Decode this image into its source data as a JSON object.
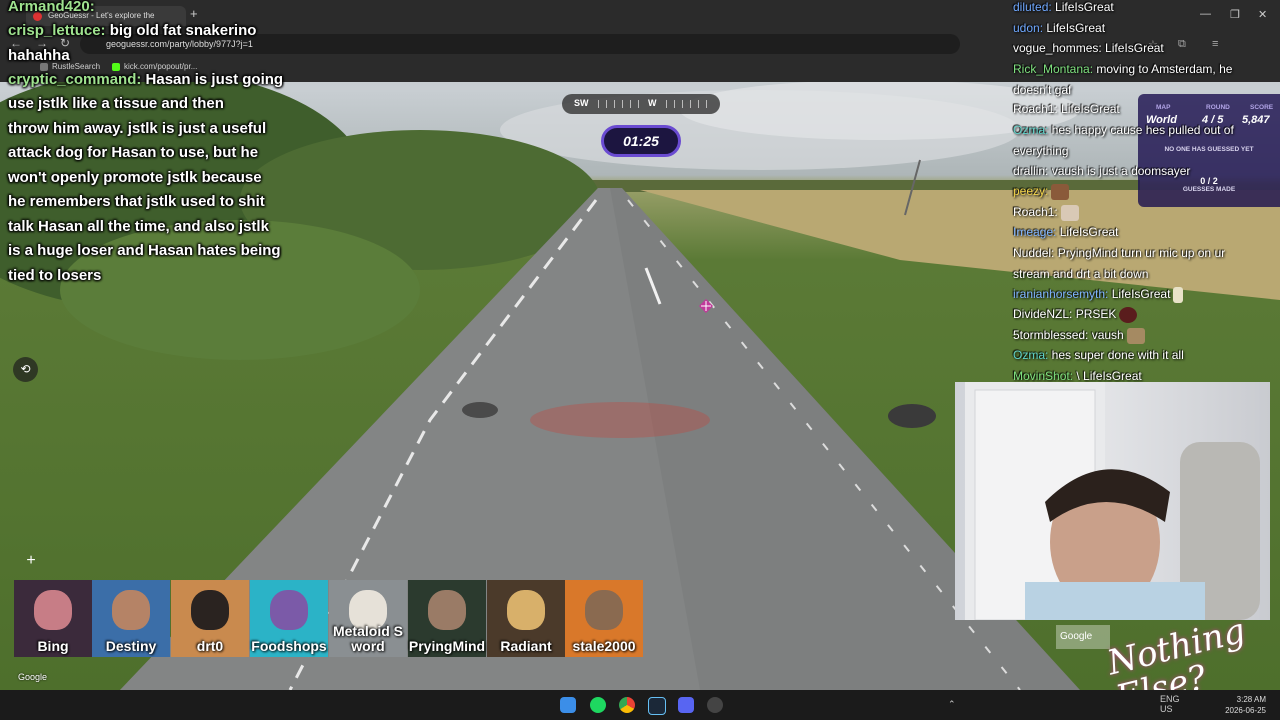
{
  "browser": {
    "tab_title": "GeoGuessr - Let's explore the",
    "new_tab": "+",
    "address": "geoguessr.com/party/lobby/977J?j=1",
    "bookmarks": [
      "RustleSearch",
      "kick.com/popout/pr..."
    ],
    "window_controls": [
      "—",
      "❐",
      "✕"
    ]
  },
  "left_chat": [
    {
      "user": "Armand420:",
      "text": ""
    },
    {
      "user": "crisp_lettuce:",
      "text": " big old fat snakerino"
    },
    {
      "user": "",
      "text": "hahahha"
    },
    {
      "user": "cryptic_command:",
      "text": " Hasan is just going"
    },
    {
      "user": "",
      "text": "use jstlk like a tissue and then"
    },
    {
      "user": "",
      "text": "throw him away. jstlk is just a useful"
    },
    {
      "user": "",
      "text": "attack dog for Hasan to use, but he"
    },
    {
      "user": "",
      "text": "won't openly promote jstlk because"
    },
    {
      "user": "",
      "text": "he remembers that jstlk used to shit"
    },
    {
      "user": "",
      "text": "talk Hasan all the time, and also jstlk"
    },
    {
      "user": "",
      "text": "is a huge loser and Hasan hates being"
    },
    {
      "user": "",
      "text": "tied to losers"
    }
  ],
  "right_chat": [
    {
      "user": "diluted:",
      "text": " LifeIsGreat",
      "color": "#6fa8ff",
      "emote": ""
    },
    {
      "user": "udon:",
      "text": " LifeIsGreat",
      "color": "#6fa8ff",
      "emote": ""
    },
    {
      "user": "vogue_hommes:",
      "text": " LifeIsGreat",
      "color": "#ffffff",
      "emote": ""
    },
    {
      "user": "Rick_Montana:",
      "text": " moving to Amsterdam, he doesn't gaf",
      "color": "#7ee07e",
      "emote": ""
    },
    {
      "user": "Roach1:",
      "text": " LifeIsGreat",
      "color": "#ffffff",
      "emote": ""
    },
    {
      "user": "Ozma:",
      "text": " hes happy cause hes pulled out of everything",
      "color": "#5fd1c8",
      "emote": ""
    },
    {
      "user": "drallin:",
      "text": " vaush is just a doomsayer",
      "color": "#ffffff",
      "emote": ""
    },
    {
      "user": "peezy:",
      "text": "",
      "color": "#f0d24a",
      "emote": "#8a5a3a"
    },
    {
      "user": "Roach1:",
      "text": "",
      "color": "#ffffff",
      "emote": "#d9c9b6"
    },
    {
      "user": "Imeage:",
      "text": " LifeIsGreat",
      "color": "#7fb4ff",
      "emote": ""
    },
    {
      "user": "Nuddel:",
      "text": " PryingMind turn ur mic up on ur stream and drt a bit down",
      "color": "#ffffff",
      "emote": ""
    },
    {
      "user": "iranianhorsemyth:",
      "text": " LifeIsGreat",
      "color": "#7fb4ff",
      "emote": "#e8e2c8"
    },
    {
      "user": "DivideNZL:",
      "text": " PRSEK",
      "color": "#ffffff",
      "emote": "#5a1d1d"
    },
    {
      "user": "5tormblessed:",
      "text": " vaush",
      "color": "#ffffff",
      "emote": "#a58a62"
    },
    {
      "user": "Ozma:",
      "text": " hes super done with it all",
      "color": "#5fd1c8",
      "emote": ""
    },
    {
      "user": "MovinShot:",
      "text": " \\ LifeIsGreat",
      "color": "#7ee07e",
      "emote": ""
    }
  ],
  "hud": {
    "compass": {
      "left": "SW",
      "center": "W"
    },
    "timer": "01:25",
    "map_label": "MAP",
    "map_value": "World",
    "round_label": "ROUND",
    "round_value": "4 / 5",
    "score_label": "SCORE",
    "score_value": "5,847",
    "guess_status": "NO ONE HAS GUESSED YET",
    "guess_count": "0 / 2",
    "guess_label": "GUESSES MADE",
    "zoom_in": "+",
    "zoom_out": "−",
    "google": "Google",
    "google_btn": "Google",
    "watermark": "Nothing Else?"
  },
  "players": [
    {
      "name": "Bing",
      "bg": "#3b2a3b",
      "face": "#c77d86"
    },
    {
      "name": "Destiny",
      "bg": "#3b6ea8",
      "face": "#b58366"
    },
    {
      "name": "drt0",
      "bg": "#c98a4e",
      "face": "#2a2320"
    },
    {
      "name": "Foodshops",
      "bg": "#2bb3c7",
      "face": "#7b5aa8"
    },
    {
      "name": "Metaloid Sword",
      "bg": "#8a8f92",
      "face": "#e6e1d8"
    },
    {
      "name": "PryingMind",
      "bg": "#2b3a2e",
      "face": "#9a7b66"
    },
    {
      "name": "Radiant",
      "bg": "#4b3a2a",
      "face": "#d8b06a"
    },
    {
      "name": "stale2000",
      "bg": "#d9782a",
      "face": "#8a6a50"
    }
  ],
  "taskbar": {
    "tray_lang": "ENG",
    "tray_region": "US",
    "time": "3:28 AM",
    "date": "2026-06-25"
  },
  "colors": {
    "accent": "#6a4bd1",
    "hud_bg": "#1e1450"
  }
}
